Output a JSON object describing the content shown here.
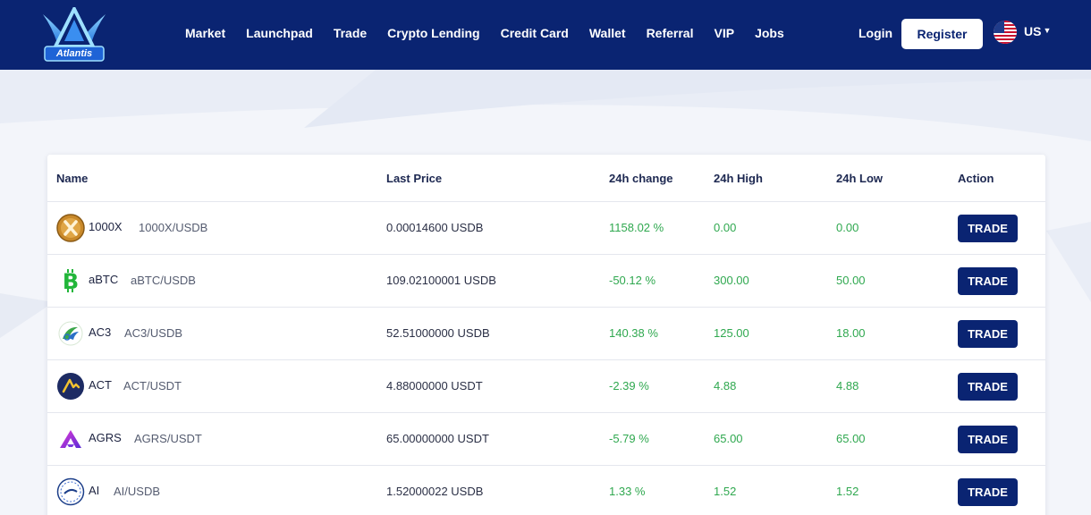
{
  "header": {
    "logo_text": "Atlantis",
    "nav": [
      "Market",
      "Launchpad",
      "Trade",
      "Crypto Lending",
      "Credit Card",
      "Wallet",
      "Referral",
      "VIP",
      "Jobs"
    ],
    "login_label": "Login",
    "register_label": "Register",
    "language": "US",
    "flag_icon": "us-flag-icon"
  },
  "table": {
    "columns": {
      "name": "Name",
      "last_price": "Last Price",
      "change": "24h change",
      "high": "24h High",
      "low": "24h Low",
      "action": "Action"
    },
    "rows": [
      {
        "symbol": "1000X",
        "pair": "1000X/USDB",
        "price": "0.00014600 USDB",
        "change": "1158.02 %",
        "high": "0.00",
        "low": "0.00",
        "action": "TRADE",
        "icon": "1000x-coin-icon"
      },
      {
        "symbol": "aBTC",
        "pair": "aBTC/USDB",
        "price": "109.02100001 USDB",
        "change": "-50.12 %",
        "high": "300.00",
        "low": "50.00",
        "action": "TRADE",
        "icon": "abtc-coin-icon"
      },
      {
        "symbol": "AC3",
        "pair": "AC3/USDB",
        "price": "52.51000000 USDB",
        "change": "140.38 %",
        "high": "125.00",
        "low": "18.00",
        "action": "TRADE",
        "icon": "ac3-coin-icon"
      },
      {
        "symbol": "ACT",
        "pair": "ACT/USDT",
        "price": "4.88000000 USDT",
        "change": "-2.39 %",
        "high": "4.88",
        "low": "4.88",
        "action": "TRADE",
        "icon": "act-coin-icon"
      },
      {
        "symbol": "AGRS",
        "pair": "AGRS/USDT",
        "price": "65.00000000 USDT",
        "change": "-5.79 %",
        "high": "65.00",
        "low": "65.00",
        "action": "TRADE",
        "icon": "agrs-coin-icon"
      },
      {
        "symbol": "AI",
        "pair": "AI/USDB",
        "price": "1.52000022 USDB",
        "change": "1.33 %",
        "high": "1.52",
        "low": "1.52",
        "action": "TRADE",
        "icon": "ai-coin-icon"
      }
    ]
  },
  "colors": {
    "brand_navy": "#0a2472",
    "positive_green": "#2fa84f"
  }
}
